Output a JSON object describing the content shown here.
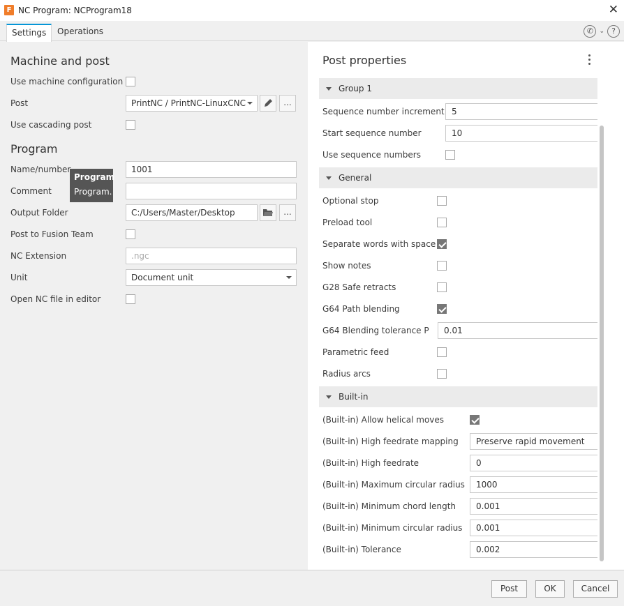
{
  "window": {
    "title": "NC Program: NCProgram18",
    "app_logo": "F"
  },
  "tabs": [
    "Settings",
    "Operations"
  ],
  "machine_post": {
    "heading": "Machine and post",
    "use_machine_config_label": "Use machine configuration",
    "use_machine_config_checked": false,
    "post_label": "Post",
    "post_value": "PrintNC / PrintNC-LinuxCNC",
    "more_label": "...",
    "use_cascading_label": "Use cascading post",
    "use_cascading_checked": false
  },
  "program": {
    "heading": "Program",
    "name_label": "Name/number",
    "name_value": "1001",
    "comment_label": "Comment",
    "comment_value": "",
    "output_label": "Output Folder",
    "output_value": "C:/Users/Master/Desktop",
    "more_label": "...",
    "post_team_label": "Post to Fusion Team",
    "post_team_checked": false,
    "nc_ext_label": "NC Extension",
    "nc_ext_value": ".ngc",
    "unit_label": "Unit",
    "unit_value": "Document unit",
    "open_nc_label": "Open NC file in editor",
    "open_nc_checked": false
  },
  "tooltip": {
    "title": "Program",
    "body": "Program."
  },
  "post_properties": {
    "title": "Post properties",
    "groups": {
      "group1": {
        "label": "Group 1",
        "rows": [
          {
            "label": "Sequence number increment",
            "value": "5"
          },
          {
            "label": "Start sequence number",
            "value": "10"
          },
          {
            "label": "Use sequence numbers",
            "checked": false
          }
        ]
      },
      "general": {
        "label": "General",
        "rows": [
          {
            "label": "Optional stop",
            "checked": false
          },
          {
            "label": "Preload tool",
            "checked": false
          },
          {
            "label": "Separate words with space",
            "checked": true
          },
          {
            "label": "Show notes",
            "checked": false
          },
          {
            "label": "G28 Safe retracts",
            "checked": false
          },
          {
            "label": "G64 Path blending",
            "checked": true
          },
          {
            "label": "G64 Blending tolerance P",
            "value": "0.01"
          },
          {
            "label": "Parametric feed",
            "checked": false
          },
          {
            "label": "Radius arcs",
            "checked": false
          }
        ]
      },
      "builtin": {
        "label": "Built-in",
        "rows": [
          {
            "label": "(Built-in) Allow helical moves",
            "checked": true
          },
          {
            "label": "(Built-in) High feedrate mapping",
            "value": "Preserve rapid movement"
          },
          {
            "label": "(Built-in) High feedrate",
            "value": "0"
          },
          {
            "label": "(Built-in) Maximum circular radius",
            "value": "1000"
          },
          {
            "label": "(Built-in) Minimum chord length",
            "value": "0.001"
          },
          {
            "label": "(Built-in) Minimum circular radius",
            "value": "0.001"
          },
          {
            "label": "(Built-in) Tolerance",
            "value": "0.002"
          }
        ]
      }
    }
  },
  "buttons": {
    "post": "Post",
    "ok": "OK",
    "cancel": "Cancel"
  }
}
